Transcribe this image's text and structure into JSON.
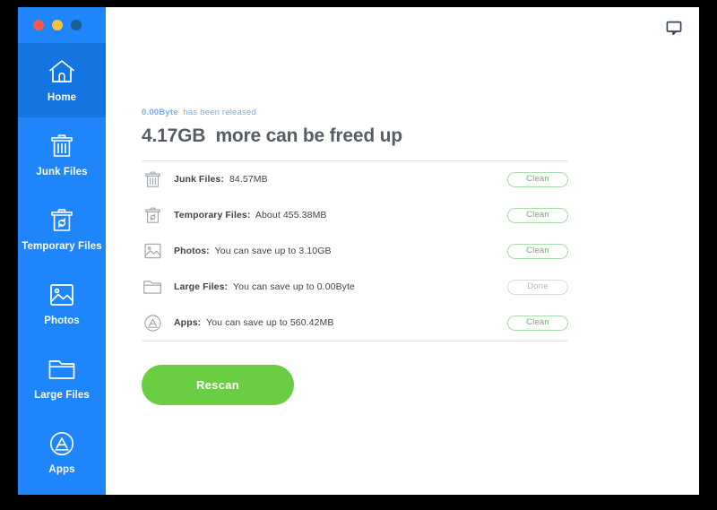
{
  "window": {
    "traffic_lights": [
      {
        "name": "close",
        "color": "#f9564f"
      },
      {
        "name": "minimize",
        "color": "#f9c03a"
      },
      {
        "name": "zoom",
        "color": "#1b5d96"
      }
    ],
    "feedback_icon": "chat-bubble-icon"
  },
  "sidebar": {
    "background_color": "#1e86fa",
    "active_background_color": "#1275e2",
    "items": [
      {
        "id": "home",
        "label": "Home",
        "icon": "house-icon",
        "active": true
      },
      {
        "id": "junk-files",
        "label": "Junk Files",
        "icon": "trash-icon",
        "active": false
      },
      {
        "id": "temporary-files",
        "label": "Temporary Files",
        "icon": "recycle-trash-icon",
        "active": false
      },
      {
        "id": "photos",
        "label": "Photos",
        "icon": "photo-icon",
        "active": false
      },
      {
        "id": "large-files",
        "label": "Large Files",
        "icon": "folder-icon",
        "active": false
      },
      {
        "id": "apps",
        "label": "Apps",
        "icon": "app-store-icon",
        "active": false
      }
    ]
  },
  "main": {
    "released_amount": "0.00Byte",
    "released_suffix": "  has been released",
    "headline": "4.17GB  more can be freed up",
    "rows": [
      {
        "id": "junk-files",
        "icon": "trash-icon",
        "label": "Junk Files:",
        "value": "  84.57MB",
        "action_label": "Clean",
        "action_state": "enabled"
      },
      {
        "id": "temporary-files",
        "icon": "recycle-trash-icon",
        "label": "Temporary Files:",
        "value": "  About 455.38MB",
        "action_label": "Clean",
        "action_state": "enabled"
      },
      {
        "id": "photos",
        "icon": "photo-icon",
        "label": "Photos:",
        "value": "  You can save up to 3.10GB",
        "action_label": "Clean",
        "action_state": "enabled"
      },
      {
        "id": "large-files",
        "icon": "folder-icon",
        "label": "Large Files:",
        "value": "  You can save up to 0.00Byte",
        "action_label": "Done",
        "action_state": "done"
      },
      {
        "id": "apps",
        "icon": "app-store-icon",
        "label": "Apps:",
        "value": "  You can save up to 560.42MB",
        "action_label": "Clean",
        "action_state": "enabled"
      }
    ],
    "rescan_label": "Rescan",
    "accent_color": "#6ace43",
    "clean_color": "#5eb95e"
  }
}
